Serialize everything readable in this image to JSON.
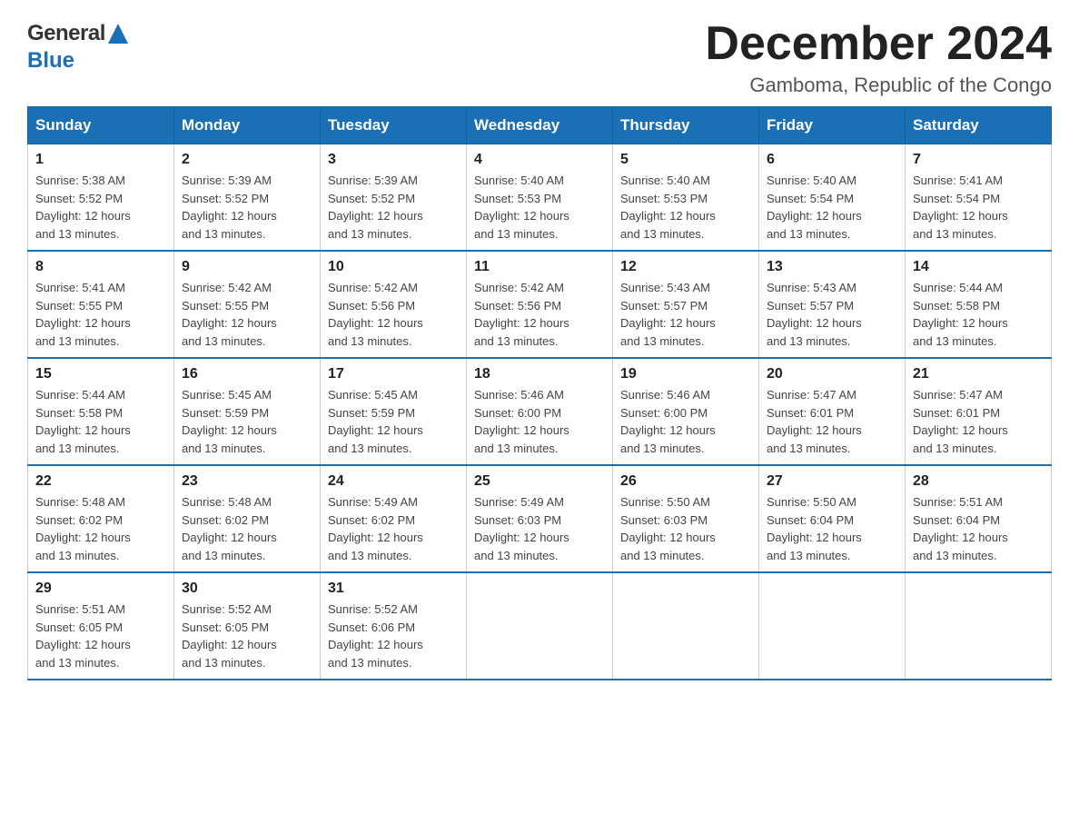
{
  "header": {
    "logo": {
      "general": "General",
      "blue": "Blue"
    },
    "title": "December 2024",
    "subtitle": "Gamboma, Republic of the Congo"
  },
  "weekdays": [
    "Sunday",
    "Monday",
    "Tuesday",
    "Wednesday",
    "Thursday",
    "Friday",
    "Saturday"
  ],
  "weeks": [
    [
      {
        "day": "1",
        "sunrise": "5:38 AM",
        "sunset": "5:52 PM",
        "daylight": "12 hours and 13 minutes."
      },
      {
        "day": "2",
        "sunrise": "5:39 AM",
        "sunset": "5:52 PM",
        "daylight": "12 hours and 13 minutes."
      },
      {
        "day": "3",
        "sunrise": "5:39 AM",
        "sunset": "5:52 PM",
        "daylight": "12 hours and 13 minutes."
      },
      {
        "day": "4",
        "sunrise": "5:40 AM",
        "sunset": "5:53 PM",
        "daylight": "12 hours and 13 minutes."
      },
      {
        "day": "5",
        "sunrise": "5:40 AM",
        "sunset": "5:53 PM",
        "daylight": "12 hours and 13 minutes."
      },
      {
        "day": "6",
        "sunrise": "5:40 AM",
        "sunset": "5:54 PM",
        "daylight": "12 hours and 13 minutes."
      },
      {
        "day": "7",
        "sunrise": "5:41 AM",
        "sunset": "5:54 PM",
        "daylight": "12 hours and 13 minutes."
      }
    ],
    [
      {
        "day": "8",
        "sunrise": "5:41 AM",
        "sunset": "5:55 PM",
        "daylight": "12 hours and 13 minutes."
      },
      {
        "day": "9",
        "sunrise": "5:42 AM",
        "sunset": "5:55 PM",
        "daylight": "12 hours and 13 minutes."
      },
      {
        "day": "10",
        "sunrise": "5:42 AM",
        "sunset": "5:56 PM",
        "daylight": "12 hours and 13 minutes."
      },
      {
        "day": "11",
        "sunrise": "5:42 AM",
        "sunset": "5:56 PM",
        "daylight": "12 hours and 13 minutes."
      },
      {
        "day": "12",
        "sunrise": "5:43 AM",
        "sunset": "5:57 PM",
        "daylight": "12 hours and 13 minutes."
      },
      {
        "day": "13",
        "sunrise": "5:43 AM",
        "sunset": "5:57 PM",
        "daylight": "12 hours and 13 minutes."
      },
      {
        "day": "14",
        "sunrise": "5:44 AM",
        "sunset": "5:58 PM",
        "daylight": "12 hours and 13 minutes."
      }
    ],
    [
      {
        "day": "15",
        "sunrise": "5:44 AM",
        "sunset": "5:58 PM",
        "daylight": "12 hours and 13 minutes."
      },
      {
        "day": "16",
        "sunrise": "5:45 AM",
        "sunset": "5:59 PM",
        "daylight": "12 hours and 13 minutes."
      },
      {
        "day": "17",
        "sunrise": "5:45 AM",
        "sunset": "5:59 PM",
        "daylight": "12 hours and 13 minutes."
      },
      {
        "day": "18",
        "sunrise": "5:46 AM",
        "sunset": "6:00 PM",
        "daylight": "12 hours and 13 minutes."
      },
      {
        "day": "19",
        "sunrise": "5:46 AM",
        "sunset": "6:00 PM",
        "daylight": "12 hours and 13 minutes."
      },
      {
        "day": "20",
        "sunrise": "5:47 AM",
        "sunset": "6:01 PM",
        "daylight": "12 hours and 13 minutes."
      },
      {
        "day": "21",
        "sunrise": "5:47 AM",
        "sunset": "6:01 PM",
        "daylight": "12 hours and 13 minutes."
      }
    ],
    [
      {
        "day": "22",
        "sunrise": "5:48 AM",
        "sunset": "6:02 PM",
        "daylight": "12 hours and 13 minutes."
      },
      {
        "day": "23",
        "sunrise": "5:48 AM",
        "sunset": "6:02 PM",
        "daylight": "12 hours and 13 minutes."
      },
      {
        "day": "24",
        "sunrise": "5:49 AM",
        "sunset": "6:02 PM",
        "daylight": "12 hours and 13 minutes."
      },
      {
        "day": "25",
        "sunrise": "5:49 AM",
        "sunset": "6:03 PM",
        "daylight": "12 hours and 13 minutes."
      },
      {
        "day": "26",
        "sunrise": "5:50 AM",
        "sunset": "6:03 PM",
        "daylight": "12 hours and 13 minutes."
      },
      {
        "day": "27",
        "sunrise": "5:50 AM",
        "sunset": "6:04 PM",
        "daylight": "12 hours and 13 minutes."
      },
      {
        "day": "28",
        "sunrise": "5:51 AM",
        "sunset": "6:04 PM",
        "daylight": "12 hours and 13 minutes."
      }
    ],
    [
      {
        "day": "29",
        "sunrise": "5:51 AM",
        "sunset": "6:05 PM",
        "daylight": "12 hours and 13 minutes."
      },
      {
        "day": "30",
        "sunrise": "5:52 AM",
        "sunset": "6:05 PM",
        "daylight": "12 hours and 13 minutes."
      },
      {
        "day": "31",
        "sunrise": "5:52 AM",
        "sunset": "6:06 PM",
        "daylight": "12 hours and 13 minutes."
      },
      null,
      null,
      null,
      null
    ]
  ],
  "labels": {
    "sunrise": "Sunrise:",
    "sunset": "Sunset:",
    "daylight": "Daylight:"
  },
  "colors": {
    "header_bg": "#1a6fb5",
    "border": "#1a6fb5"
  }
}
